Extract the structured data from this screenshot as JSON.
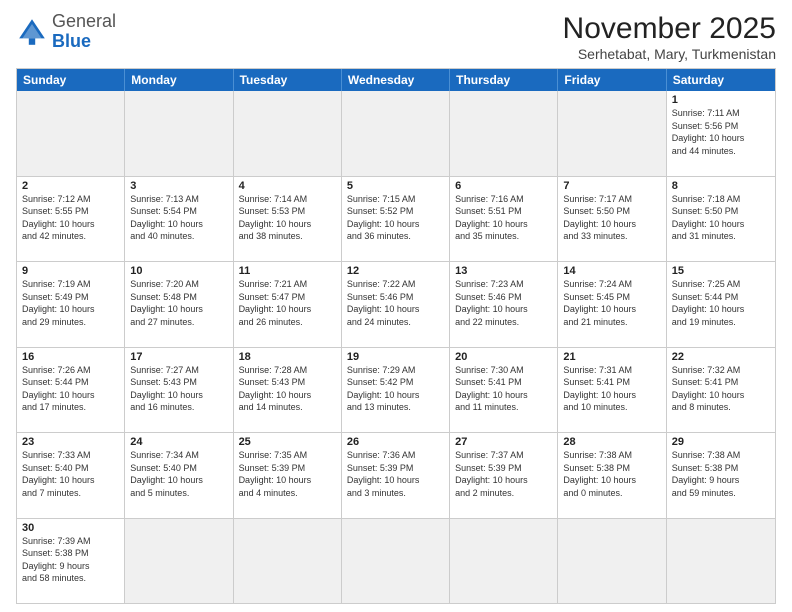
{
  "logo": {
    "general": "General",
    "blue": "Blue"
  },
  "title": "November 2025",
  "location": "Serhetabat, Mary, Turkmenistan",
  "weekdays": [
    "Sunday",
    "Monday",
    "Tuesday",
    "Wednesday",
    "Thursday",
    "Friday",
    "Saturday"
  ],
  "rows": [
    [
      {
        "day": "",
        "info": "",
        "shaded": true
      },
      {
        "day": "",
        "info": "",
        "shaded": true
      },
      {
        "day": "",
        "info": "",
        "shaded": true
      },
      {
        "day": "",
        "info": "",
        "shaded": true
      },
      {
        "day": "",
        "info": "",
        "shaded": true
      },
      {
        "day": "",
        "info": "",
        "shaded": true
      },
      {
        "day": "1",
        "info": "Sunrise: 7:11 AM\nSunset: 5:56 PM\nDaylight: 10 hours\nand 44 minutes."
      }
    ],
    [
      {
        "day": "2",
        "info": "Sunrise: 7:12 AM\nSunset: 5:55 PM\nDaylight: 10 hours\nand 42 minutes."
      },
      {
        "day": "3",
        "info": "Sunrise: 7:13 AM\nSunset: 5:54 PM\nDaylight: 10 hours\nand 40 minutes."
      },
      {
        "day": "4",
        "info": "Sunrise: 7:14 AM\nSunset: 5:53 PM\nDaylight: 10 hours\nand 38 minutes."
      },
      {
        "day": "5",
        "info": "Sunrise: 7:15 AM\nSunset: 5:52 PM\nDaylight: 10 hours\nand 36 minutes."
      },
      {
        "day": "6",
        "info": "Sunrise: 7:16 AM\nSunset: 5:51 PM\nDaylight: 10 hours\nand 35 minutes."
      },
      {
        "day": "7",
        "info": "Sunrise: 7:17 AM\nSunset: 5:50 PM\nDaylight: 10 hours\nand 33 minutes."
      },
      {
        "day": "8",
        "info": "Sunrise: 7:18 AM\nSunset: 5:50 PM\nDaylight: 10 hours\nand 31 minutes."
      }
    ],
    [
      {
        "day": "9",
        "info": "Sunrise: 7:19 AM\nSunset: 5:49 PM\nDaylight: 10 hours\nand 29 minutes."
      },
      {
        "day": "10",
        "info": "Sunrise: 7:20 AM\nSunset: 5:48 PM\nDaylight: 10 hours\nand 27 minutes."
      },
      {
        "day": "11",
        "info": "Sunrise: 7:21 AM\nSunset: 5:47 PM\nDaylight: 10 hours\nand 26 minutes."
      },
      {
        "day": "12",
        "info": "Sunrise: 7:22 AM\nSunset: 5:46 PM\nDaylight: 10 hours\nand 24 minutes."
      },
      {
        "day": "13",
        "info": "Sunrise: 7:23 AM\nSunset: 5:46 PM\nDaylight: 10 hours\nand 22 minutes."
      },
      {
        "day": "14",
        "info": "Sunrise: 7:24 AM\nSunset: 5:45 PM\nDaylight: 10 hours\nand 21 minutes."
      },
      {
        "day": "15",
        "info": "Sunrise: 7:25 AM\nSunset: 5:44 PM\nDaylight: 10 hours\nand 19 minutes."
      }
    ],
    [
      {
        "day": "16",
        "info": "Sunrise: 7:26 AM\nSunset: 5:44 PM\nDaylight: 10 hours\nand 17 minutes."
      },
      {
        "day": "17",
        "info": "Sunrise: 7:27 AM\nSunset: 5:43 PM\nDaylight: 10 hours\nand 16 minutes."
      },
      {
        "day": "18",
        "info": "Sunrise: 7:28 AM\nSunset: 5:43 PM\nDaylight: 10 hours\nand 14 minutes."
      },
      {
        "day": "19",
        "info": "Sunrise: 7:29 AM\nSunset: 5:42 PM\nDaylight: 10 hours\nand 13 minutes."
      },
      {
        "day": "20",
        "info": "Sunrise: 7:30 AM\nSunset: 5:41 PM\nDaylight: 10 hours\nand 11 minutes."
      },
      {
        "day": "21",
        "info": "Sunrise: 7:31 AM\nSunset: 5:41 PM\nDaylight: 10 hours\nand 10 minutes."
      },
      {
        "day": "22",
        "info": "Sunrise: 7:32 AM\nSunset: 5:41 PM\nDaylight: 10 hours\nand 8 minutes."
      }
    ],
    [
      {
        "day": "23",
        "info": "Sunrise: 7:33 AM\nSunset: 5:40 PM\nDaylight: 10 hours\nand 7 minutes."
      },
      {
        "day": "24",
        "info": "Sunrise: 7:34 AM\nSunset: 5:40 PM\nDaylight: 10 hours\nand 5 minutes."
      },
      {
        "day": "25",
        "info": "Sunrise: 7:35 AM\nSunset: 5:39 PM\nDaylight: 10 hours\nand 4 minutes."
      },
      {
        "day": "26",
        "info": "Sunrise: 7:36 AM\nSunset: 5:39 PM\nDaylight: 10 hours\nand 3 minutes."
      },
      {
        "day": "27",
        "info": "Sunrise: 7:37 AM\nSunset: 5:39 PM\nDaylight: 10 hours\nand 2 minutes."
      },
      {
        "day": "28",
        "info": "Sunrise: 7:38 AM\nSunset: 5:38 PM\nDaylight: 10 hours\nand 0 minutes."
      },
      {
        "day": "29",
        "info": "Sunrise: 7:38 AM\nSunset: 5:38 PM\nDaylight: 9 hours\nand 59 minutes."
      }
    ],
    [
      {
        "day": "30",
        "info": "Sunrise: 7:39 AM\nSunset: 5:38 PM\nDaylight: 9 hours\nand 58 minutes."
      },
      {
        "day": "",
        "info": "",
        "shaded": true
      },
      {
        "day": "",
        "info": "",
        "shaded": true
      },
      {
        "day": "",
        "info": "",
        "shaded": true
      },
      {
        "day": "",
        "info": "",
        "shaded": true
      },
      {
        "day": "",
        "info": "",
        "shaded": true
      },
      {
        "day": "",
        "info": "",
        "shaded": true
      }
    ]
  ]
}
